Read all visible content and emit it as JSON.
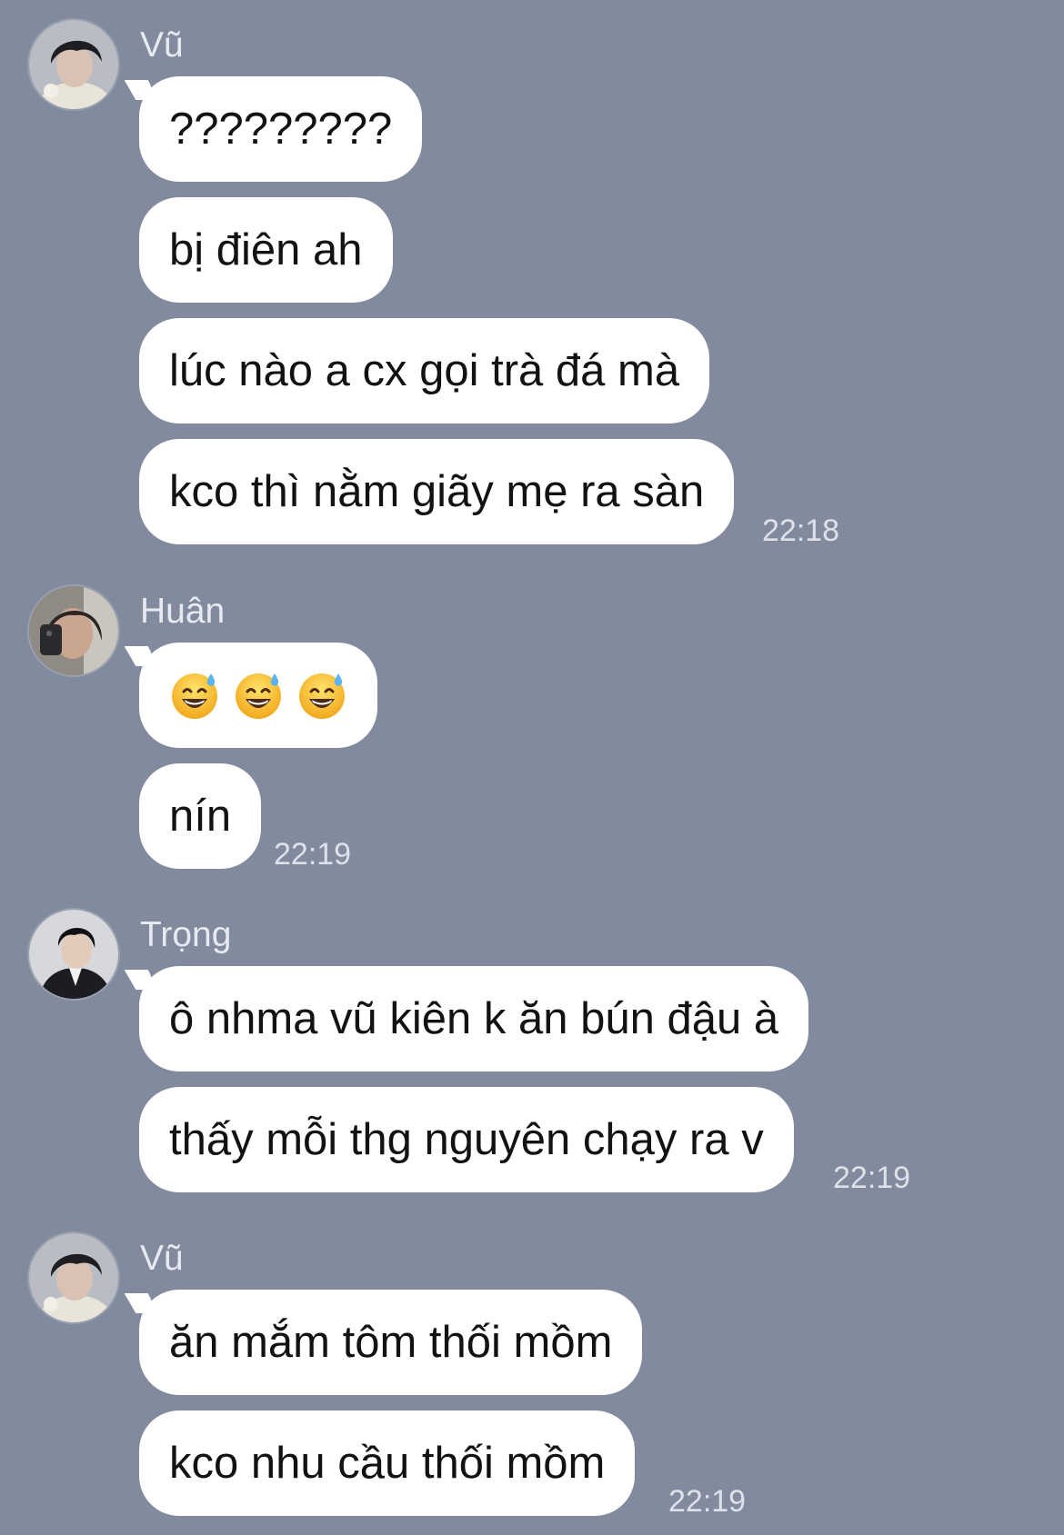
{
  "colors": {
    "background": "#818b9d",
    "bubble": "#ffffff",
    "text": "#121212",
    "sender_name": "#e6eaf1",
    "timestamp": "#dde2ea"
  },
  "groups": [
    {
      "sender": "Vũ",
      "avatar_icon": "profile-photo-icon",
      "messages": [
        "?????????",
        "bị điên ah",
        "lúc nào a cx gọi trà đá mà",
        "kco thì nằm giãy mẹ ra sàn"
      ],
      "time": "22:18"
    },
    {
      "sender": "Huân",
      "avatar_icon": "profile-photo-icon",
      "messages": [
        "😅😅😅",
        "nín"
      ],
      "emoji_icons": [
        "grinning-face-with-sweat-icon",
        "grinning-face-with-sweat-icon",
        "grinning-face-with-sweat-icon"
      ],
      "time": "22:19"
    },
    {
      "sender": "Trọng",
      "avatar_icon": "profile-photo-icon",
      "messages": [
        "ô nhma vũ kiên k ăn bún đậu à",
        "thấy mỗi thg nguyên chạy ra v"
      ],
      "time": "22:19"
    },
    {
      "sender": "Vũ",
      "avatar_icon": "profile-photo-icon",
      "messages": [
        "ăn mắm tôm thối mồm",
        "kco nhu cầu thối mồm"
      ],
      "time": "22:19"
    }
  ]
}
